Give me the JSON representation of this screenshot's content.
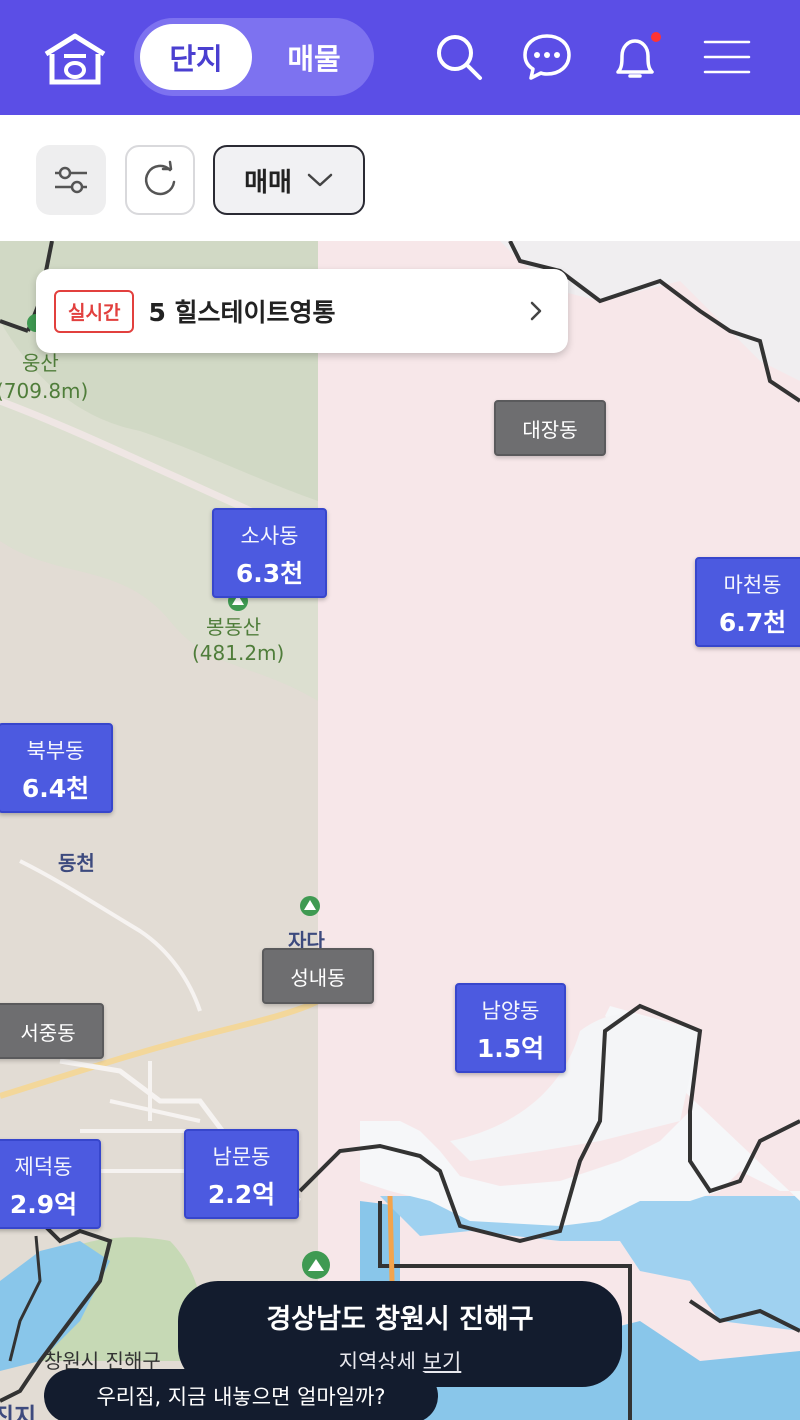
{
  "header": {
    "tabs": [
      {
        "label": "단지",
        "active": true
      },
      {
        "label": "매물",
        "active": false
      }
    ],
    "icons": [
      "home-logo-icon",
      "search-icon",
      "chat-icon",
      "bell-icon",
      "menu-icon"
    ],
    "notification_dot": true,
    "accent_color": "#5b4ee6"
  },
  "toolbar": {
    "deal_type": "매매",
    "icons": [
      "filter-sliders-icon",
      "refresh-icon",
      "chevron-down-icon"
    ]
  },
  "realtime": {
    "badge": "실시간",
    "text": "5 힐스테이트영통"
  },
  "map": {
    "markers": [
      {
        "name": "소사동",
        "price": "6.3천"
      },
      {
        "name": "마천동",
        "price": "6.7천"
      },
      {
        "name": "북부동",
        "price": "6.4천"
      },
      {
        "name": "남양동",
        "price": "1.5억"
      },
      {
        "name": "제덕동",
        "price": "2.9억"
      },
      {
        "name": "남문동",
        "price": "2.2억"
      }
    ],
    "gray_labels": [
      "대장동",
      "성내동",
      "서중동"
    ],
    "places": {
      "mountain1": "웅산",
      "mountain1_height": "(709.8m)",
      "mountain2": "봉동산",
      "mountain2_height": "(481.2m)",
      "area1": "동천",
      "partial1": "자다",
      "partial2": "창원시 진해구",
      "partial3": "진지"
    }
  },
  "region": {
    "title": "경상남도 창원시 진해구",
    "detail_prefix": "지역상세",
    "detail_link": "보기"
  },
  "promo": {
    "text": "우리집, 지금 내놓으면 얼마일까?"
  }
}
